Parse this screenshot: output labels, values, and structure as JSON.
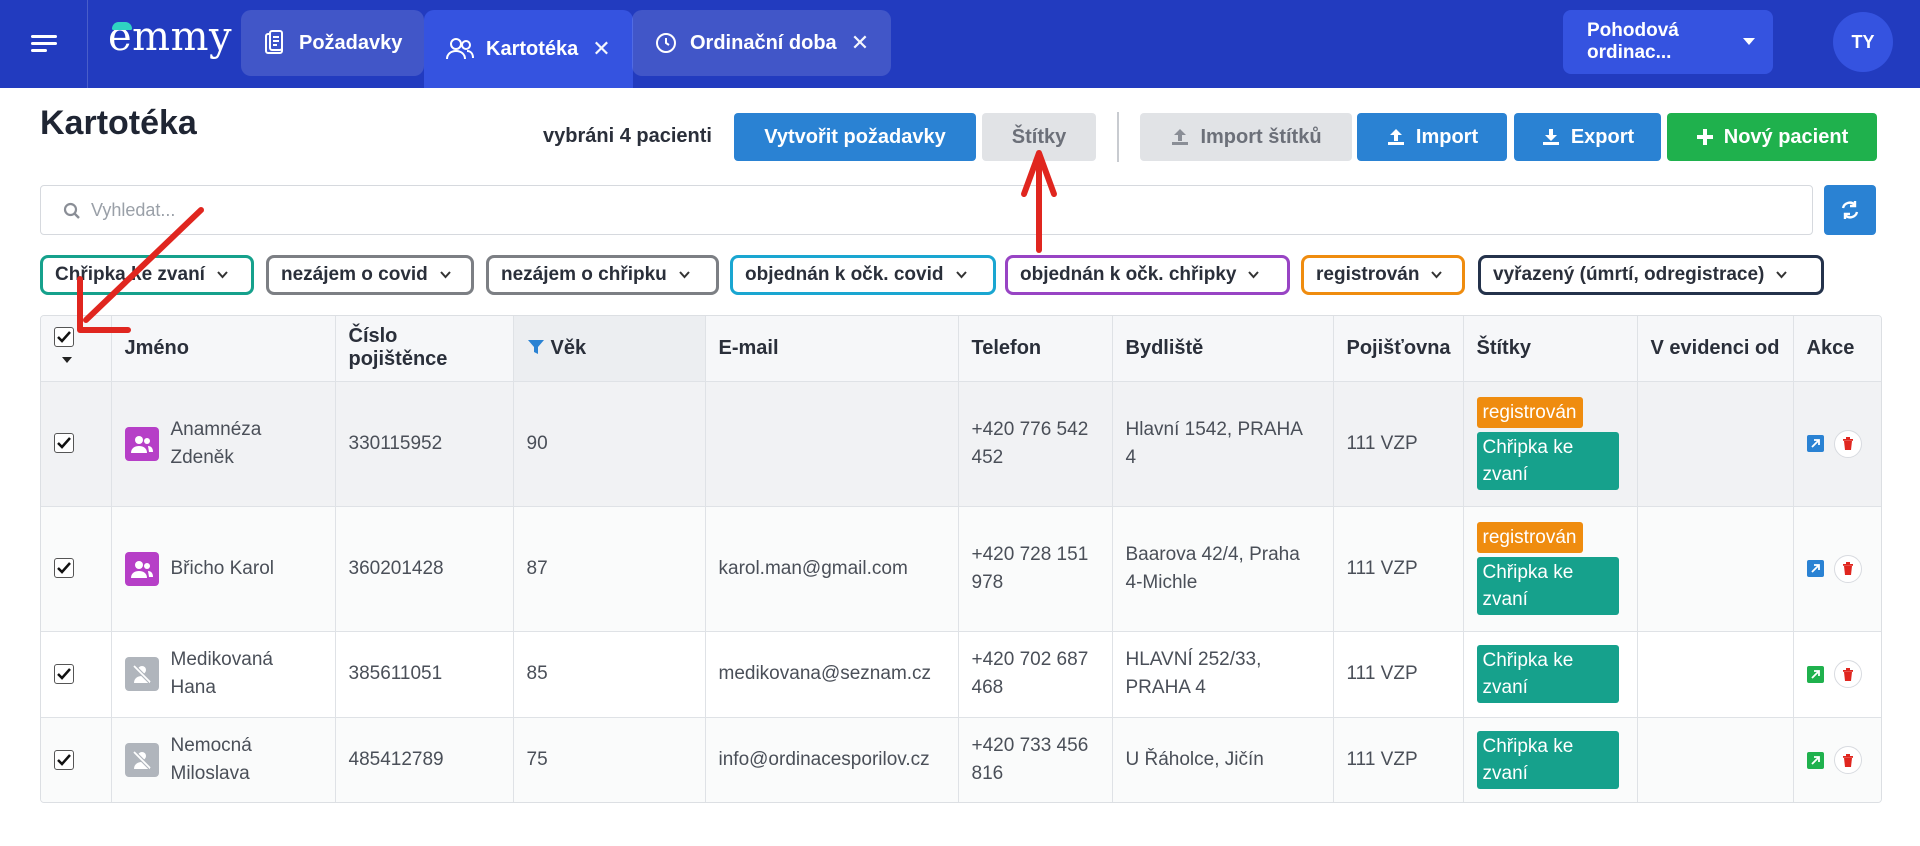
{
  "topbar": {
    "logo": "emmy",
    "tabs": [
      {
        "label": "Požadavky",
        "icon": "clipboard-icon",
        "closable": false
      },
      {
        "label": "Kartotéka",
        "icon": "users-icon",
        "closable": true
      },
      {
        "label": "Ordinační doba",
        "icon": "clock-icon",
        "closable": true
      }
    ],
    "close_glyph": "✕",
    "practice": "Pohodová ordinac...",
    "user_initials": "TY"
  },
  "header": {
    "title": "Kartotéka",
    "selected_text": "vybráni 4 pacienti",
    "buttons": {
      "create_requests": "Vytvořit požadavky",
      "tags": "Štítky",
      "import_tags": "Import štítků",
      "import": "Import",
      "export": "Export",
      "new_patient": "Nový pacient"
    }
  },
  "search": {
    "placeholder": "Vyhledat..."
  },
  "filters": [
    {
      "label": "Chřipka ke zvaní",
      "color": "#16a18c"
    },
    {
      "label": "nezájem o covid",
      "color": "#7c7f84"
    },
    {
      "label": "nezájem o chřipku",
      "color": "#7c7f84"
    },
    {
      "label": "objednán k očk. covid",
      "color": "#1aa6d1"
    },
    {
      "label": "objednán k očk. chřipky",
      "color": "#9844c4"
    },
    {
      "label": "registrován",
      "color": "#ef8c0f"
    },
    {
      "label": "vyřazený (úmrtí, odregistrace)",
      "color": "#24324b"
    }
  ],
  "table": {
    "columns": {
      "name": "Jméno",
      "insurance_number": "Číslo pojištěnce",
      "age": "Věk",
      "email": "E-mail",
      "phone": "Telefon",
      "address": "Bydliště",
      "insurer": "Pojišťovna",
      "tags": "Štítky",
      "since": "V evidenci od",
      "actions": "Akce"
    },
    "rows": [
      {
        "name_first": "Anamnéza",
        "name_last": "Zdeněk",
        "insurance_number": "330115952",
        "age": "90",
        "email": "",
        "phone1": "+420 776 542",
        "phone2": "452",
        "addr1": "Hlavní 1542, PRAHA",
        "addr2": "4",
        "insurer": "111 VZP",
        "tag_reg": "registrován",
        "tag_flu1": "Chřipka ke",
        "tag_flu2": "zvaní",
        "since": ""
      },
      {
        "name_first": "Břicho Karol",
        "name_last": "",
        "insurance_number": "360201428",
        "age": "87",
        "email": "karol.man@gmail.com",
        "phone1": "+420 728 151",
        "phone2": "978",
        "addr1": "Baarova 42/4, Praha",
        "addr2": "4-Michle",
        "insurer": "111 VZP",
        "tag_reg": "registrován",
        "tag_flu1": "Chřipka ke",
        "tag_flu2": "zvaní",
        "since": ""
      },
      {
        "name_first": "Medikovaná",
        "name_last": "Hana",
        "insurance_number": "385611051",
        "age": "85",
        "email": "medikovana@seznam.cz",
        "phone1": "+420 702 687",
        "phone2": "468",
        "addr1": "HLAVNÍ 252/33,",
        "addr2": "PRAHA 4",
        "insurer": "111 VZP",
        "tag_flu1": "Chřipka ke",
        "tag_flu2": "zvaní",
        "since": ""
      },
      {
        "name_first": "Nemocná",
        "name_last": "Miloslava",
        "insurance_number": "485412789",
        "age": "75",
        "email": "info@ordinacesporilov.cz",
        "phone1": "+420 733 456",
        "phone2": "816",
        "addr1": "U Řáholce, Jičín",
        "addr2": "",
        "insurer": "111 VZP",
        "tag_flu1": "Chřipka ke",
        "tag_flu2": "zvaní",
        "since": ""
      }
    ]
  },
  "colors": {
    "topbar": "#223bbf",
    "primary": "#2a82d3",
    "success": "#1fb14d",
    "annotation": "#e0261f"
  }
}
